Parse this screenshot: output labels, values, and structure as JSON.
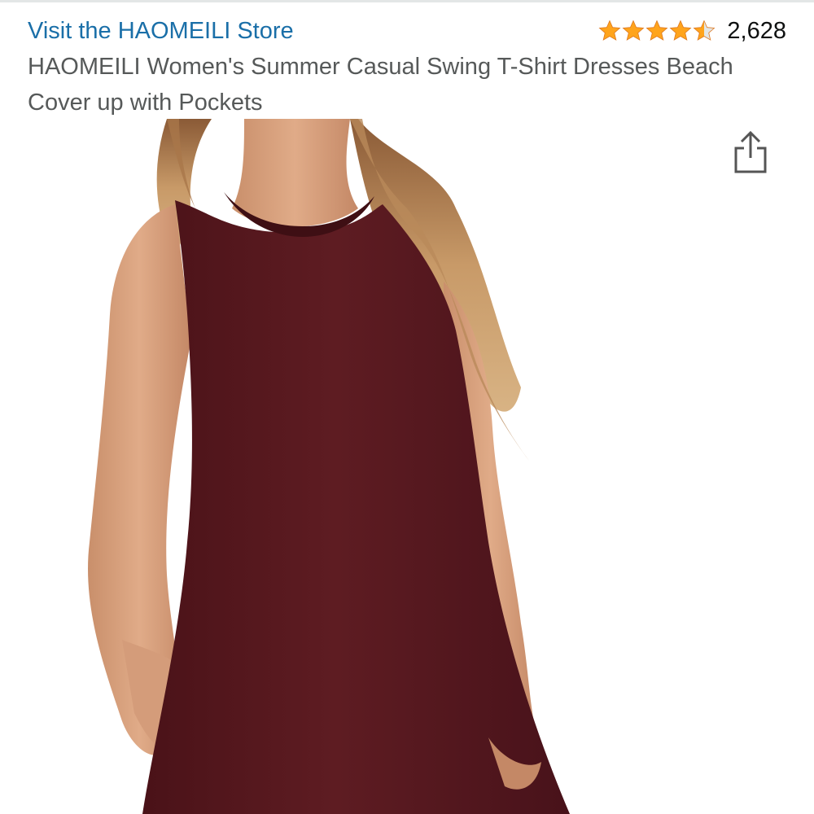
{
  "header": {
    "store_link": "Visit the HAOMEILI Store",
    "rating_count": "2,628",
    "rating_stars": 4.5,
    "star_color": "#ffa41c"
  },
  "product": {
    "title": "HAOMEILI Women's Summer Casual Swing T-Shirt Dresses Beach Cover up with Pockets",
    "image_alt": "Woman wearing a burgundy sleeveless swing dress",
    "dress_color": "#5a1a1f"
  },
  "actions": {
    "share_icon": "share-icon"
  }
}
